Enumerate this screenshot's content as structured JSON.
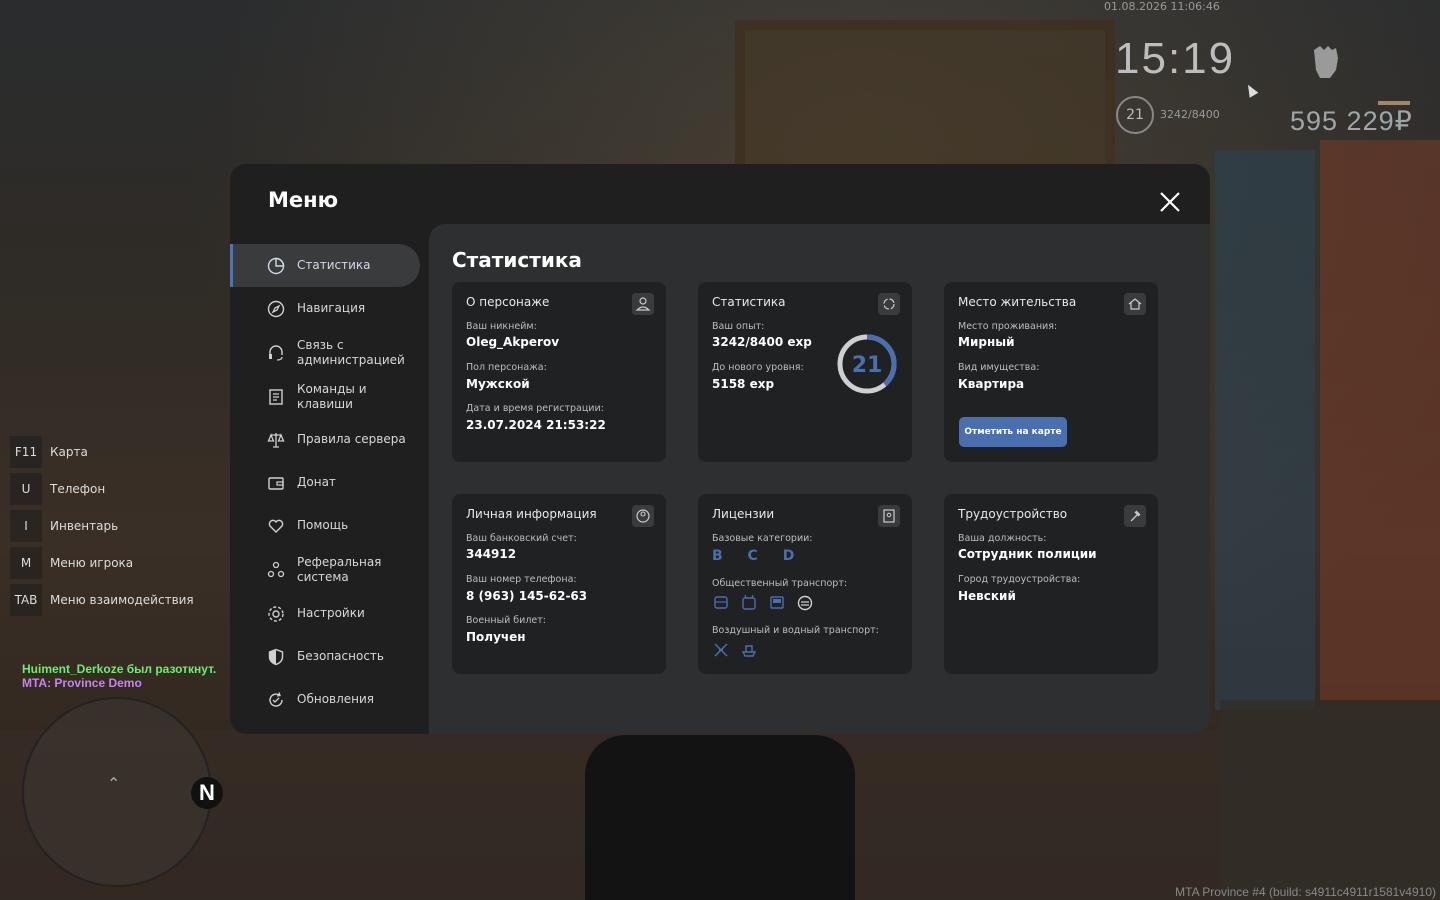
{
  "hud": {
    "datetime": "01.08.2026 11:06:46",
    "clock": "15:19",
    "level": "21",
    "exp": "3242/8400",
    "money": "595 229₽"
  },
  "keybinds": [
    {
      "key": "F11",
      "label": "Карта"
    },
    {
      "key": "U",
      "label": "Телефон"
    },
    {
      "key": "I",
      "label": "Инвентарь"
    },
    {
      "key": "M",
      "label": "Меню игрока"
    },
    {
      "key": "TAB",
      "label": "Меню взаимодействия"
    }
  ],
  "chat": {
    "line1": "Huiment_Derkoze был разоткнут.",
    "line2": "MTA: Province Demo"
  },
  "minimap": {
    "north": "N"
  },
  "build": "MTA Province #4 (build: s4911c4911r1581v4910)",
  "menu": {
    "title": "Меню",
    "sidebar": [
      {
        "label": "Статистика",
        "icon": "stats-icon"
      },
      {
        "label": "Навигация",
        "icon": "compass-icon"
      },
      {
        "label": "Связь с администрацией",
        "icon": "headset-icon"
      },
      {
        "label": "Команды и клавиши",
        "icon": "document-icon"
      },
      {
        "label": "Правила сервера",
        "icon": "scales-icon"
      },
      {
        "label": "Донат",
        "icon": "wallet-icon"
      },
      {
        "label": "Помощь",
        "icon": "heart-hand-icon"
      },
      {
        "label": "Реферальная система",
        "icon": "referral-icon"
      },
      {
        "label": "Настройки",
        "icon": "gear-icon"
      },
      {
        "label": "Безопасность",
        "icon": "shield-icon"
      },
      {
        "label": "Обновления",
        "icon": "refresh-icon"
      }
    ],
    "content_title": "Статистика",
    "cards": {
      "character": {
        "title": "О персонаже",
        "nick_label": "Ваш никнейм:",
        "nick": "Oleg_Akperov",
        "gender_label": "Пол персонажа:",
        "gender": "Мужской",
        "reg_label": "Дата и время регистрации:",
        "reg": "23.07.2024 21:53:22"
      },
      "stats": {
        "title": "Статистика",
        "exp_label": "Ваш опыт:",
        "exp": "3242/8400 exp",
        "next_label": "До нового уровня:",
        "next": "5158 exp",
        "level": "21",
        "progress": 0.386
      },
      "residence": {
        "title": "Место жительства",
        "place_label": "Место проживания:",
        "place": "Мирный",
        "property_label": "Вид имущества:",
        "property": "Квартира",
        "button": "Отметить на карте"
      },
      "personal": {
        "title": "Личная информация",
        "bank_label": "Ваш банковский счет:",
        "bank": "344912",
        "phone_label": "Ваш номер телефона:",
        "phone": "8 (963) 145-62-63",
        "military_label": "Военный билет:",
        "military": "Получен"
      },
      "licenses": {
        "title": "Лицензии",
        "base_label": "Базовые категории:",
        "base": "B C D",
        "public_label": "Общественный транспорт:",
        "air_label": "Воздушный и водный транспорт:"
      },
      "employment": {
        "title": "Трудоустройство",
        "position_label": "Ваша должность:",
        "position": "Сотрудник полиции",
        "city_label": "Город трудоустройства:",
        "city": "Невский"
      }
    }
  },
  "colors": {
    "accent": "#4a6fae",
    "panel": "#1f1f20",
    "content": "#2e2f30",
    "card": "#202122"
  }
}
